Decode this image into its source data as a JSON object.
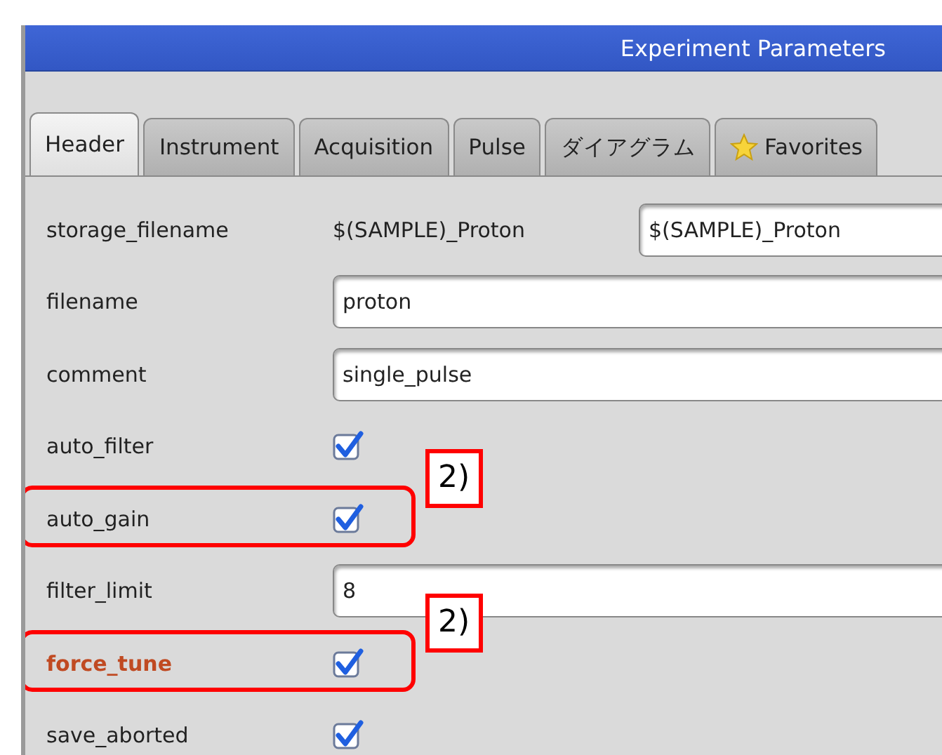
{
  "window": {
    "title": "Experiment Parameters"
  },
  "tabs": [
    {
      "label": "Header",
      "selected": true,
      "kind": "plain"
    },
    {
      "label": "Instrument",
      "selected": false,
      "kind": "plain"
    },
    {
      "label": "Acquisition",
      "selected": false,
      "kind": "plain"
    },
    {
      "label": "Pulse",
      "selected": false,
      "kind": "plain"
    },
    {
      "label": "ダイアグラム",
      "selected": false,
      "kind": "plain"
    },
    {
      "label": "Favorites",
      "selected": false,
      "kind": "favorites"
    }
  ],
  "parameters": [
    {
      "kind": "text_and_field",
      "name": "storage_filename",
      "text": "$(SAMPLE)_Proton",
      "value": "$(SAMPLE)_Proton",
      "modified": false,
      "highlighted": false
    },
    {
      "kind": "field",
      "name": "filename",
      "value": "proton",
      "modified": false,
      "highlighted": false
    },
    {
      "kind": "field",
      "name": "comment",
      "value": "single_pulse",
      "modified": false,
      "highlighted": false
    },
    {
      "kind": "checkbox",
      "name": "auto_filter",
      "checked": true,
      "modified": false,
      "highlighted": false
    },
    {
      "kind": "checkbox",
      "name": "auto_gain",
      "checked": true,
      "modified": false,
      "highlighted": true,
      "callout": "2)"
    },
    {
      "kind": "field",
      "name": "filter_limit",
      "value": "8",
      "modified": false,
      "highlighted": false
    },
    {
      "kind": "checkbox",
      "name": "force_tune",
      "checked": true,
      "modified": true,
      "highlighted": true,
      "callout": "2)"
    },
    {
      "kind": "checkbox",
      "name": "save_aborted",
      "checked": true,
      "modified": false,
      "highlighted": false
    }
  ]
}
